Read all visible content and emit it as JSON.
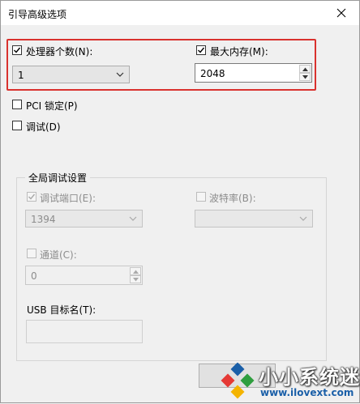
{
  "window": {
    "title": "引导高级选项"
  },
  "processor": {
    "label": "处理器个数(N):",
    "checked": true,
    "value": "1"
  },
  "memory": {
    "label": "最大内存(M):",
    "checked": true,
    "value": "2048"
  },
  "pci_lock": {
    "label": "PCI 锁定(P)",
    "checked": false
  },
  "debug": {
    "label": "调试(D)",
    "checked": false
  },
  "global_debug": {
    "title": "全局调试设置",
    "debug_port": {
      "label": "调试端口(E):",
      "checked": true,
      "value": "1394"
    },
    "baud_rate": {
      "label": "波特率(B):",
      "checked": false,
      "value": ""
    },
    "channel": {
      "label": "通道(C):",
      "checked": false,
      "value": "0"
    },
    "usb_target": {
      "label": "USB 目标名(T):",
      "value": ""
    }
  },
  "watermark": {
    "brand": "小小系统迷",
    "url": "www.ilovext.com"
  },
  "colors": {
    "highlight": "#d9322e",
    "watermark_url": "#1a5fa8"
  }
}
